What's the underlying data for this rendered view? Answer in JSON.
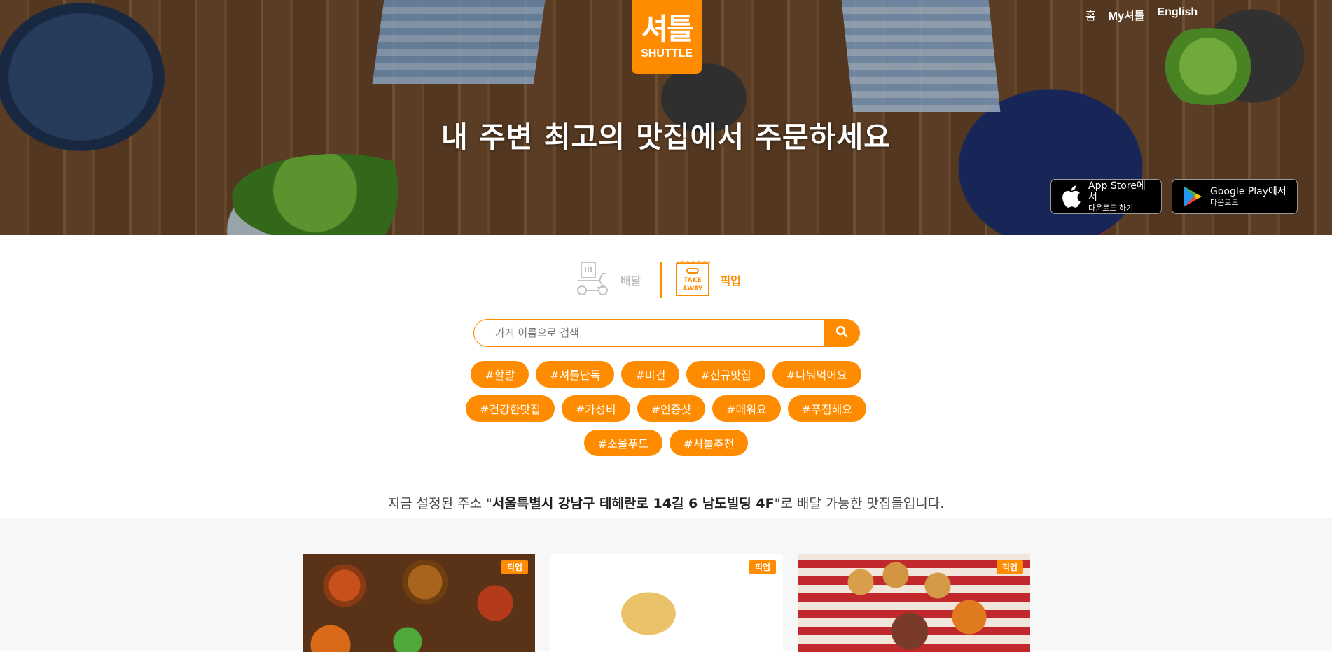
{
  "brand": {
    "logo_korean": "셔틀",
    "logo_english": "SHUTTLE",
    "accent_color": "#ff8c00"
  },
  "topnav": {
    "home": "홈",
    "my": "My셔틀",
    "english": "English"
  },
  "hero": {
    "headline": "내 주변 최고의 맛집에서 주문하세요"
  },
  "app_store": {
    "line1": "App Store에서",
    "line2": "다운로드 하기",
    "icon": "apple-icon"
  },
  "google_play": {
    "line1": "Google Play에서",
    "line2": "다운로드",
    "icon": "google-play-icon"
  },
  "modes": {
    "delivery": {
      "label": "배달",
      "icon": "delivery-scooter-icon",
      "selected": false
    },
    "pickup": {
      "label": "픽업",
      "icon": "takeaway-bag-icon",
      "icon_text": [
        "TAKE",
        "AWAY"
      ],
      "selected": true
    }
  },
  "search": {
    "placeholder": "가게 이름으로 검색",
    "value": "",
    "icon": "search-icon"
  },
  "tags": {
    "row1": [
      "#할랄",
      "#셔틀단독",
      "#비건",
      "#신규맛집",
      "#나눠먹어요"
    ],
    "row2": [
      "#건강한맛집",
      "#가성비",
      "#인증샷",
      "#매워요",
      "#푸짐해요"
    ],
    "row3": [
      "#소울푸드",
      "#셔틀추천"
    ]
  },
  "address": {
    "prefix": "지금 설정된 주소 \"",
    "value": "서울특별시 강남구 테헤란로 14길 6 남도빌딩 4F",
    "suffix": "\"로 배달 가능한 맛집들입니다."
  },
  "cards": [
    {
      "badge": "픽업"
    },
    {
      "badge": "픽업"
    },
    {
      "badge": "픽업"
    }
  ]
}
